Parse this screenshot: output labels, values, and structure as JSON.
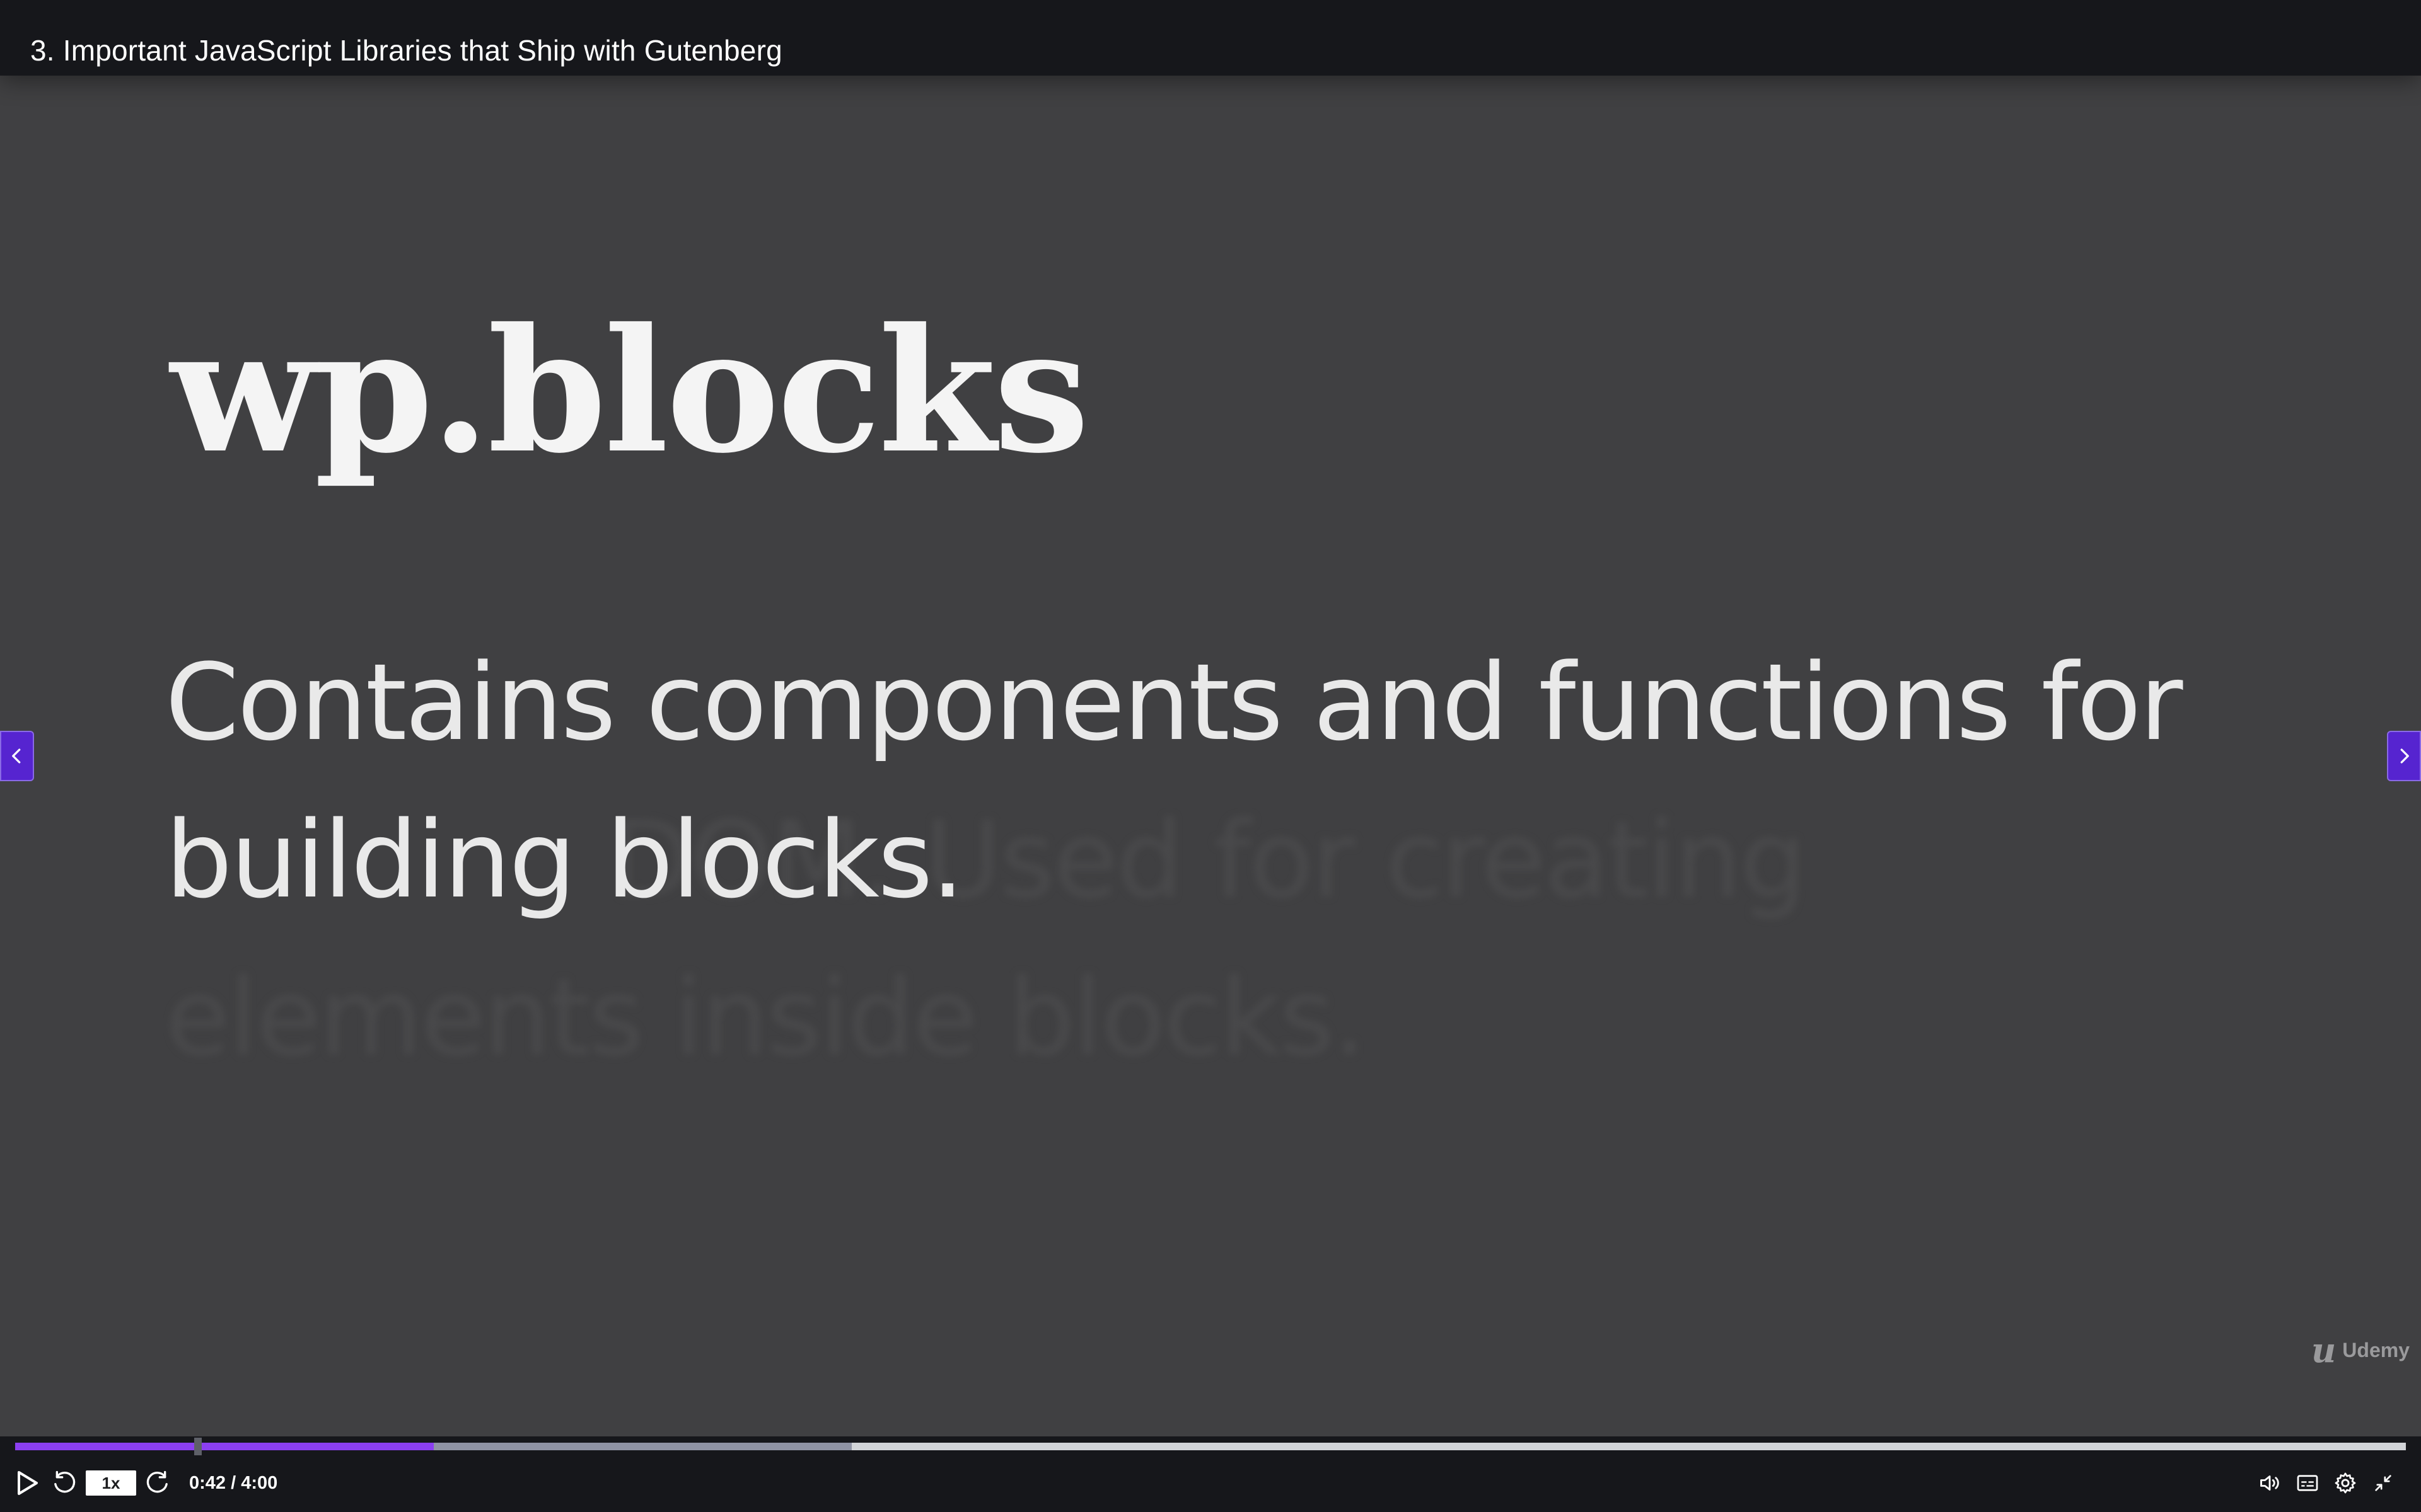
{
  "header": {
    "title": "3. Important JavaScript Libraries that Ship with Gutenberg"
  },
  "slide": {
    "heading": "wp.blocks",
    "body": "Contains components and functions for building blocks.",
    "ghost_lines": [
      "",
      "              DOM. Used for creating",
      "elements inside blocks."
    ]
  },
  "watermark": {
    "mark": "u",
    "text": "Udemy"
  },
  "player": {
    "speed_label": "1x",
    "current_time": "0:42",
    "separator": " / ",
    "duration": "4:00",
    "progress_fraction": 0.175,
    "buffered_fraction": 0.35,
    "hover_fraction": 0.075
  },
  "icons": {
    "prev": "chevron-left-icon",
    "next": "chevron-right-icon",
    "play": "play-icon",
    "rewind": "rewind-5-icon",
    "forward": "forward-5-icon",
    "volume": "volume-icon",
    "captions": "captions-icon",
    "settings": "gear-icon",
    "exit_fullscreen": "exit-fullscreen-icon"
  },
  "colors": {
    "accent": "#5624d0",
    "progress": "#8b3ff0",
    "bar_bg": "#16171b",
    "slide_bg": "#404042"
  }
}
